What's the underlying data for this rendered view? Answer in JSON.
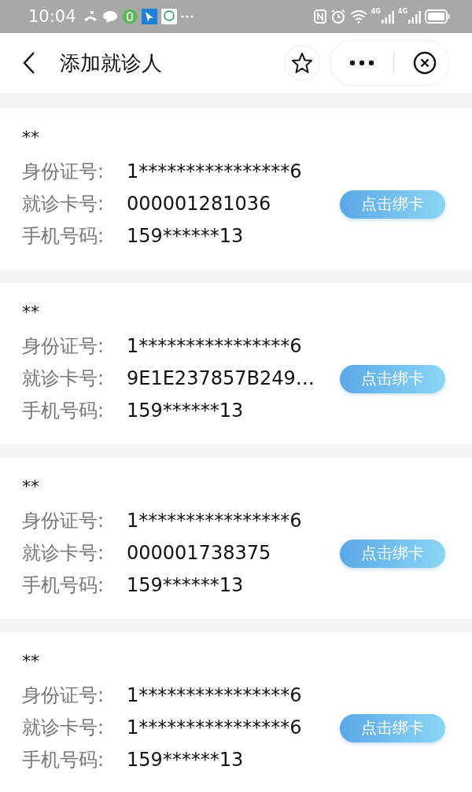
{
  "status_bar": {
    "time": "10:04",
    "networks": [
      "4G",
      "4G"
    ]
  },
  "nav": {
    "title": "添加就诊人"
  },
  "patients": [
    {
      "name": "**",
      "fields": [
        {
          "label": "身份证号:",
          "value": "1****************6"
        },
        {
          "label": "就诊卡号:",
          "value": "000001281036"
        },
        {
          "label": "手机号码:",
          "value": "159******13"
        }
      ],
      "button": "点击绑卡"
    },
    {
      "name": "**",
      "fields": [
        {
          "label": "身份证号:",
          "value": "1****************6"
        },
        {
          "label": "就诊卡号:",
          "value": "9E1E237857B249…"
        },
        {
          "label": "手机号码:",
          "value": "159******13"
        }
      ],
      "button": "点击绑卡"
    },
    {
      "name": "**",
      "fields": [
        {
          "label": "身份证号:",
          "value": "1****************6"
        },
        {
          "label": "就诊卡号:",
          "value": "000001738375"
        },
        {
          "label": "手机号码:",
          "value": "159******13"
        }
      ],
      "button": "点击绑卡"
    },
    {
      "name": "**",
      "fields": [
        {
          "label": "身份证号:",
          "value": "1****************6"
        },
        {
          "label": "就诊卡号:",
          "value": "1****************6"
        },
        {
          "label": "手机号码:",
          "value": "159******13"
        }
      ],
      "button": "点击绑卡"
    }
  ]
}
